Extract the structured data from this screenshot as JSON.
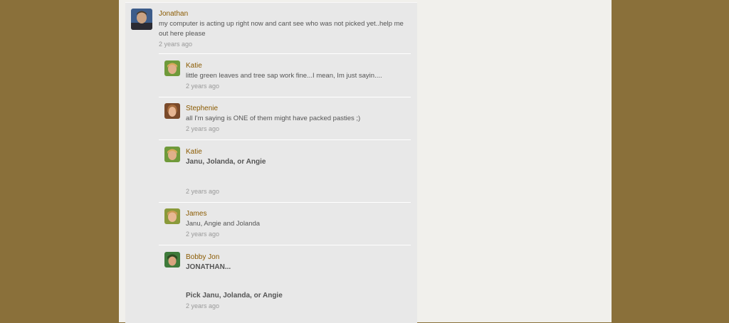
{
  "comments": [
    {
      "author": "Jonathan",
      "text": "my computer is acting up right now and cant see who was not picked yet..help me out here please",
      "time": "2 years ago",
      "avatar_icon": "user-photo-man"
    },
    {
      "author": "Katie",
      "text": "little green leaves and tree sap work fine...I mean, Im just sayin....",
      "time": "2 years ago",
      "avatar_icon": "user-photo-child"
    },
    {
      "author": "Stephenie",
      "text": "all I'm saying is ONE of them might have packed pasties ;)",
      "time": "2 years ago",
      "avatar_icon": "user-photo-woman"
    },
    {
      "author": "Katie",
      "text": "Janu, Jolanda, or Angie",
      "time": "2 years ago",
      "avatar_icon": "user-photo-child"
    },
    {
      "author": "James",
      "text": "Janu, Angie and Jolanda",
      "time": "2 years ago",
      "avatar_icon": "user-photo-child"
    },
    {
      "author": "Bobby Jon",
      "text_line1": "JONATHAN...",
      "text_line2": "Pick Janu, Jolanda, or Angie",
      "time": "2 years ago",
      "avatar_icon": "user-photo-woman-green"
    }
  ],
  "colors": {
    "background": "#8a703a",
    "panel": "#e8e8e8",
    "author": "#8a5a00"
  }
}
